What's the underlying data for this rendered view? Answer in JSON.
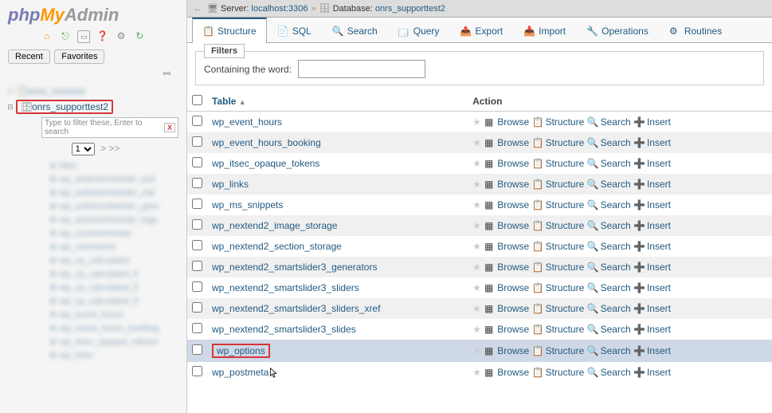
{
  "logo": {
    "php": "php",
    "my": "My",
    "admin": "Admin"
  },
  "sidebar": {
    "recent": "Recent",
    "favorites": "Favorites",
    "db_name": "onrs_supporttest2",
    "filter_placeholder": "Type to filter these, Enter to search",
    "filter_x": "X",
    "page_value": "1",
    "pager_arrows": "> >>"
  },
  "breadcrumb": {
    "server_label": "Server:",
    "server_value": "localhost:3306",
    "db_label": "Database:",
    "db_value": "onrs_supporttest2"
  },
  "tabs": {
    "structure": "Structure",
    "sql": "SQL",
    "search": "Search",
    "query": "Query",
    "export": "Export",
    "import": "Import",
    "operations": "Operations",
    "routines": "Routines"
  },
  "filters": {
    "legend": "Filters",
    "label": "Containing the word:",
    "value": ""
  },
  "table": {
    "header_table": "Table",
    "header_action": "Action"
  },
  "actions": {
    "browse": "Browse",
    "structure": "Structure",
    "search": "Search",
    "insert": "Insert"
  },
  "rows": [
    {
      "name": "wp_event_hours",
      "odd": false
    },
    {
      "name": "wp_event_hours_booking",
      "odd": true
    },
    {
      "name": "wp_itsec_opaque_tokens",
      "odd": false
    },
    {
      "name": "wp_links",
      "odd": true
    },
    {
      "name": "wp_ms_snippets",
      "odd": false
    },
    {
      "name": "wp_nextend2_image_storage",
      "odd": true
    },
    {
      "name": "wp_nextend2_section_storage",
      "odd": false
    },
    {
      "name": "wp_nextend2_smartslider3_generators",
      "odd": true
    },
    {
      "name": "wp_nextend2_smartslider3_sliders",
      "odd": false
    },
    {
      "name": "wp_nextend2_smartslider3_sliders_xref",
      "odd": true
    },
    {
      "name": "wp_nextend2_smartslider3_slides",
      "odd": false
    },
    {
      "name": "wp_options",
      "odd": true,
      "highlighted": true,
      "hover": true
    },
    {
      "name": "wp_postmeta",
      "odd": false,
      "cursor": true
    }
  ]
}
